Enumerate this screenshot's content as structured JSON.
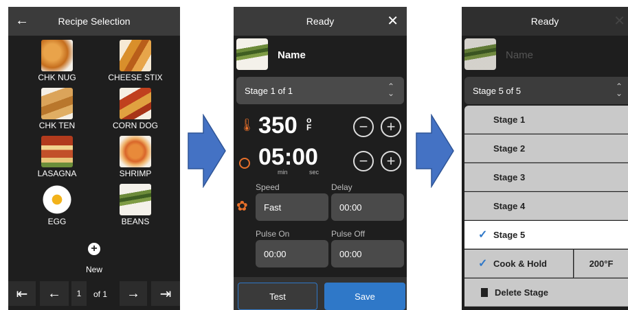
{
  "panel1": {
    "title": "Recipe Selection",
    "recipes": [
      {
        "label": "CHK NUG"
      },
      {
        "label": "CHEESE STIX"
      },
      {
        "label": "CHK TEN"
      },
      {
        "label": "CORN DOG"
      },
      {
        "label": "LASAGNA"
      },
      {
        "label": "SHRIMP"
      },
      {
        "label": "EGG"
      },
      {
        "label": "BEANS"
      }
    ],
    "new_label": "New",
    "pagination": {
      "page": "1",
      "of": "of 1"
    }
  },
  "panel2": {
    "title": "Ready",
    "name": "Name",
    "stage_select": "Stage 1 of 1",
    "temperature": {
      "value": "350",
      "unit_top": "o",
      "unit_bottom": "F"
    },
    "time": {
      "value": "05:00",
      "min_label": "min",
      "sec_label": "sec"
    },
    "speed_label": "Speed",
    "speed_value": "Fast",
    "delay_label": "Delay",
    "delay_value": "00:00",
    "pulse_on_label": "Pulse On",
    "pulse_on_value": "00:00",
    "pulse_off_label": "Pulse Off",
    "pulse_off_value": "00:00",
    "test_label": "Test",
    "save_label": "Save"
  },
  "panel3": {
    "title": "Ready",
    "name": "Name",
    "stage_select": "Stage 5 of 5",
    "stages": [
      "Stage 1",
      "Stage 2",
      "Stage 3",
      "Stage 4",
      "Stage 5"
    ],
    "selected_stage": "Stage 5",
    "cook_hold_label": "Cook & Hold",
    "cook_hold_temp": "200°F",
    "delete_label": "Delete Stage"
  },
  "colors": {
    "accent": "#2f78c8",
    "flow_arrow": "#4472c4",
    "fan": "#e8702a",
    "thermo": "#e8702a"
  }
}
